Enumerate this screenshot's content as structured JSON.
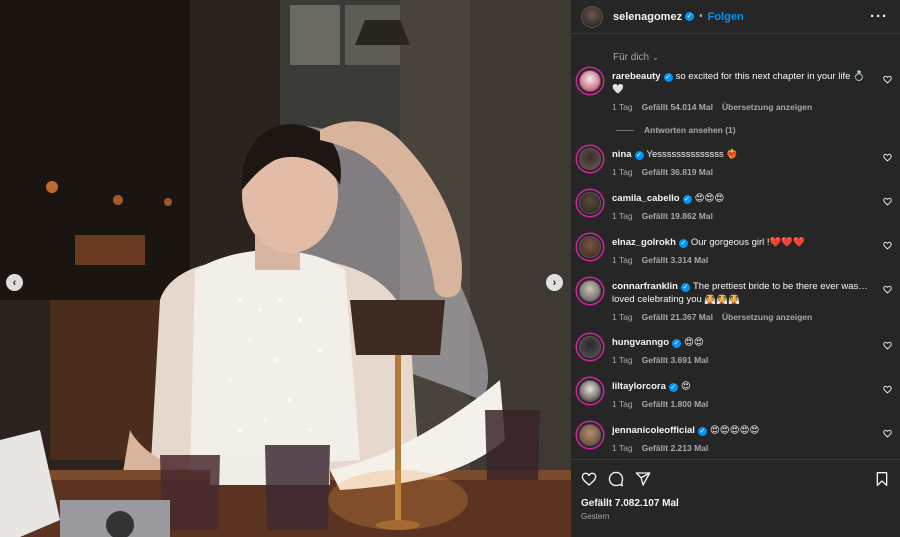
{
  "post": {
    "username": "selenagomez",
    "follow_label": "Folgen",
    "sort_label": "Für dich",
    "likes_text": "Gefällt 7.082.107 Mal",
    "date_text": "Gestern"
  },
  "comments": [
    {
      "user": "rarebeauty",
      "text": "so excited for this next chapter in your life 💍🤍",
      "age": "1 Tag",
      "likes": "Gefällt 54.014 Mal",
      "translate": "Übersetzung anzeigen"
    },
    {
      "user": "nina",
      "text": "Yessssssssssssss ❤️‍🔥",
      "age": "1 Tag",
      "likes": "Gefällt 36.819 Mal",
      "translate": ""
    },
    {
      "user": "camila_cabello",
      "text": "😍😍😍",
      "age": "1 Tag",
      "likes": "Gefällt 19.862 Mal",
      "translate": ""
    },
    {
      "user": "elnaz_golrokh",
      "text": "Our gorgeous girl !❤️❤️❤️",
      "age": "1 Tag",
      "likes": "Gefällt 3.314 Mal",
      "translate": ""
    },
    {
      "user": "connarfranklin",
      "text": "The prettiest bride to be there ever was… loved celebrating you 👰👰👰",
      "age": "1 Tag",
      "likes": "Gefällt 21.367 Mal",
      "translate": "Übersetzung anzeigen"
    },
    {
      "user": "hungvanngo",
      "text": "😍😍",
      "age": "1 Tag",
      "likes": "Gefällt 3.691 Mal",
      "translate": ""
    },
    {
      "user": "liltaylorcora",
      "text": "😍",
      "age": "1 Tag",
      "likes": "Gefällt 1.800 Mal",
      "translate": ""
    },
    {
      "user": "jennanicoleofficial",
      "text": "😍😍😍😍😍",
      "age": "1 Tag",
      "likes": "Gefällt 2.213 Mal",
      "translate": ""
    }
  ],
  "replies_label": "Antworten ansehen (1)",
  "colors": {
    "panel": "#262626",
    "accent": "#0095f6",
    "muted": "#a8a8a8"
  }
}
